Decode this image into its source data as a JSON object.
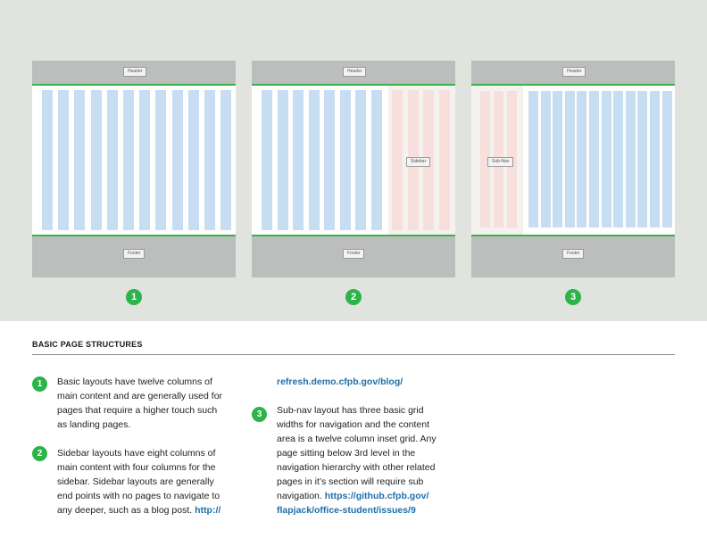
{
  "mockups": [
    {
      "header_label": "Header",
      "footer_label": "Footer",
      "number": "1"
    },
    {
      "header_label": "Header",
      "footer_label": "Footer",
      "sidebar_label": "Sidebar",
      "number": "2"
    },
    {
      "header_label": "Header",
      "footer_label": "Footer",
      "subnav_label": "Sub-Nav",
      "number": "3"
    }
  ],
  "colors": {
    "top_band": "#e1e3df",
    "header_footer": "#bcbdbd",
    "accent_green": "#2cb34a",
    "content_column": "#c7ddf1",
    "sidebar_column": "#f7dfdc",
    "link": "#1f6fa8"
  },
  "section": {
    "title": "BASIC PAGE STRUCTURES"
  },
  "notes": [
    {
      "number": "1",
      "lines": [
        "Basic layouts have twelve columns of",
        "main content and are generally used for",
        "pages  that require a higher touch such",
        "as landing pages."
      ]
    },
    {
      "number": "2",
      "lines": [
        "Sidebar layouts have eight columns of",
        "main content with four columns for the",
        "sidebar. Sidebar layouts are generally",
        "end points with no pages to navigate to"
      ],
      "last_line": "any deeper, such as a blog post.",
      "link_start": "http://",
      "link_continued": "refresh.demo.cfpb.gov/blog/"
    },
    {
      "number": "3",
      "lines": [
        "Sub-nav layout has three basic grid",
        "widths for navigation and the content",
        "area is a twelve column inset grid. Any",
        "page sitting below 3rd level in the",
        "navigation hierarchy with other related",
        "pages in it’s section will require sub"
      ],
      "last_line": "navigation.",
      "link_start": "https://github.cfpb.gov/",
      "link_continued": "flapjack/office-student/issues/9"
    }
  ]
}
